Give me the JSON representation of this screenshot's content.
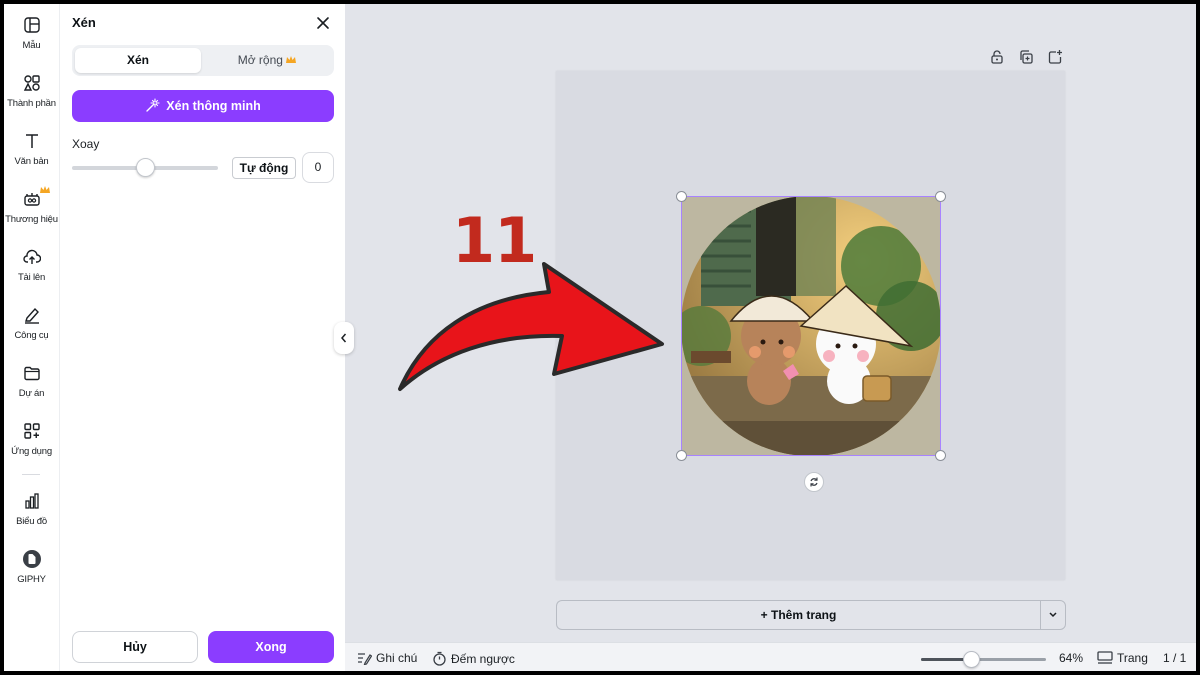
{
  "rail": {
    "items": [
      {
        "label": "Mẫu",
        "icon": "template-icon"
      },
      {
        "label": "Thành phần",
        "icon": "elements-icon"
      },
      {
        "label": "Văn bản",
        "icon": "text-icon"
      },
      {
        "label": "Thương hiệu",
        "icon": "brand-icon",
        "premium": true
      },
      {
        "label": "Tải lên",
        "icon": "upload-icon"
      },
      {
        "label": "Công cụ",
        "icon": "draw-icon"
      },
      {
        "label": "Dự án",
        "icon": "folder-icon"
      },
      {
        "label": "Ứng dụng",
        "icon": "apps-icon"
      },
      {
        "label": "Biểu đồ",
        "icon": "chart-icon"
      },
      {
        "label": "GIPHY",
        "icon": "giphy-icon"
      }
    ]
  },
  "panel": {
    "title": "Xén",
    "tabs": {
      "crop": "Xén",
      "expand": "Mở rộng"
    },
    "smart_crop": "Xén thông minh",
    "rotate": {
      "label": "Xoay",
      "auto": "Tự động",
      "value": "0",
      "level": 0.5
    },
    "cancel": "Hủy",
    "done": "Xong"
  },
  "canvas": {
    "add_page": "+ Thêm trang"
  },
  "bottombar": {
    "notes": "Ghi chú",
    "timer": "Đếm ngược",
    "zoom": "64%",
    "zoom_level": 0.4,
    "pages": "Trang",
    "page_count": "1 / 1"
  },
  "annotation": {
    "step": "11"
  },
  "colors": {
    "accent": "#8b3dff",
    "annotation": "#c22a1e",
    "arrow": "#e8141a"
  }
}
